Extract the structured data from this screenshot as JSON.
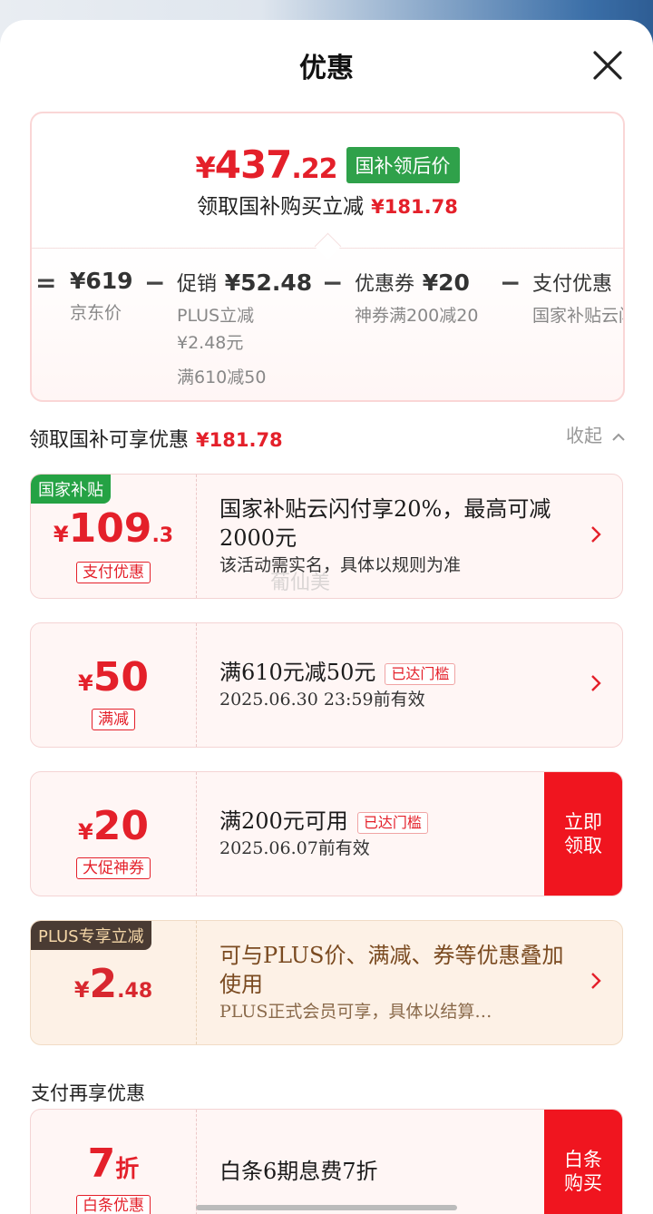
{
  "header": {
    "title": "优惠"
  },
  "summary": {
    "price_yen": "¥",
    "price_int": "437",
    "price_dec": ".22",
    "badge": "国补领后价",
    "sub_label": "领取国补购买立减",
    "sub_amount": "¥181.78",
    "breakdown": [
      {
        "op": "=",
        "main_label": "",
        "main_value": "¥619",
        "subs": [
          "京东价"
        ]
      },
      {
        "op": "−",
        "main_label": "促销",
        "main_value": "¥52.48",
        "subs": [
          "PLUS立减",
          "¥2.48元",
          "满610减50"
        ]
      },
      {
        "op": "−",
        "main_label": "优惠券",
        "main_value": "¥20",
        "subs": [
          "神券满200减20"
        ]
      },
      {
        "op": "−",
        "main_label": "支付优惠",
        "main_value": "",
        "subs": [
          "国家补贴云闪"
        ]
      }
    ]
  },
  "section": {
    "title": "领取国补可享优惠",
    "amount": "¥181.78",
    "collapse_label": "收起"
  },
  "cards": [
    {
      "badge": "国家补贴",
      "yen": "¥",
      "amount_int": "109",
      "amount_dec": ".3",
      "tag": "支付优惠",
      "title": "国家补贴云闪付享20%，最高可减2000元",
      "desc": "该活动需实名，具体以规则为准"
    },
    {
      "yen": "¥",
      "amount_int": "50",
      "tag": "满减",
      "title": "满610元减50元",
      "threshold": "已达门槛",
      "desc": "2025.06.30 23:59前有效"
    },
    {
      "yen": "¥",
      "amount_int": "20",
      "tag": "大促神券",
      "title": "满200元可用",
      "threshold": "已达门槛",
      "desc": "2025.06.07前有效",
      "action": "立即领取"
    },
    {
      "badge": "PLUS专享立减",
      "yen": "¥",
      "amount_int": "2",
      "amount_dec": ".48",
      "title": "可与PLUS价、满减、券等优惠叠加使用",
      "desc": "PLUS正式会员可享，具体以结算…"
    }
  ],
  "section2": {
    "title": "支付再享优惠"
  },
  "pay_card": {
    "amount_int": "7",
    "unit": "折",
    "tag": "白条优惠",
    "title": "白条6期息费7折",
    "action": "白条购买"
  },
  "watermark": "葡仙美",
  "colors": {
    "accent_red": "#e4202a",
    "button_red": "#f0151f",
    "gov_green": "#2fa14a",
    "plus_brown": "#4a3b33"
  },
  "icons": {
    "close": "close-icon",
    "arrow": "chevron-right-icon",
    "collapse": "chevron-up-icon"
  }
}
